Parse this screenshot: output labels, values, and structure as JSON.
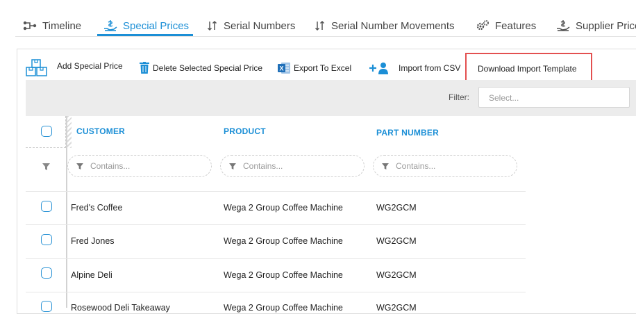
{
  "tabs": [
    {
      "label": "Timeline",
      "icon": "timeline-icon"
    },
    {
      "label": "Special Prices",
      "icon": "hand-price-icon",
      "active": true
    },
    {
      "label": "Serial Numbers",
      "icon": "sort-arrows-icon"
    },
    {
      "label": "Serial Number Movements",
      "icon": "sort-arrows-icon"
    },
    {
      "label": "Features",
      "icon": "gears-icon"
    },
    {
      "label": "Supplier Prices",
      "icon": "hand-price-icon"
    }
  ],
  "toolbar": {
    "add_label": "Add Special Price",
    "delete_label": "Delete Selected Special Price",
    "export_label": "Export To Excel",
    "import_label": "Import from CSV",
    "template_label": "Download Import Template"
  },
  "filter": {
    "label": "Filter:",
    "placeholder": "Select..."
  },
  "grid": {
    "columns": [
      "CUSTOMER",
      "PRODUCT",
      "PART NUMBER"
    ],
    "filter_placeholder": "Contains...",
    "rows": [
      {
        "customer": "Fred's Coffee",
        "product": "Wega 2 Group Coffee Machine",
        "part": "WG2GCM"
      },
      {
        "customer": "Fred Jones",
        "product": "Wega 2 Group Coffee Machine",
        "part": "WG2GCM"
      },
      {
        "customer": "Alpine Deli",
        "product": "Wega 2 Group Coffee Machine",
        "part": "WG2GCM"
      },
      {
        "customer": "Rosewood Deli Takeaway",
        "product": "Wega 2 Group Coffee Machine",
        "part": "WG2GCM"
      }
    ]
  },
  "colors": {
    "accent": "#1c8fd6",
    "highlight": "#e35050",
    "filterbar": "#ececec"
  }
}
